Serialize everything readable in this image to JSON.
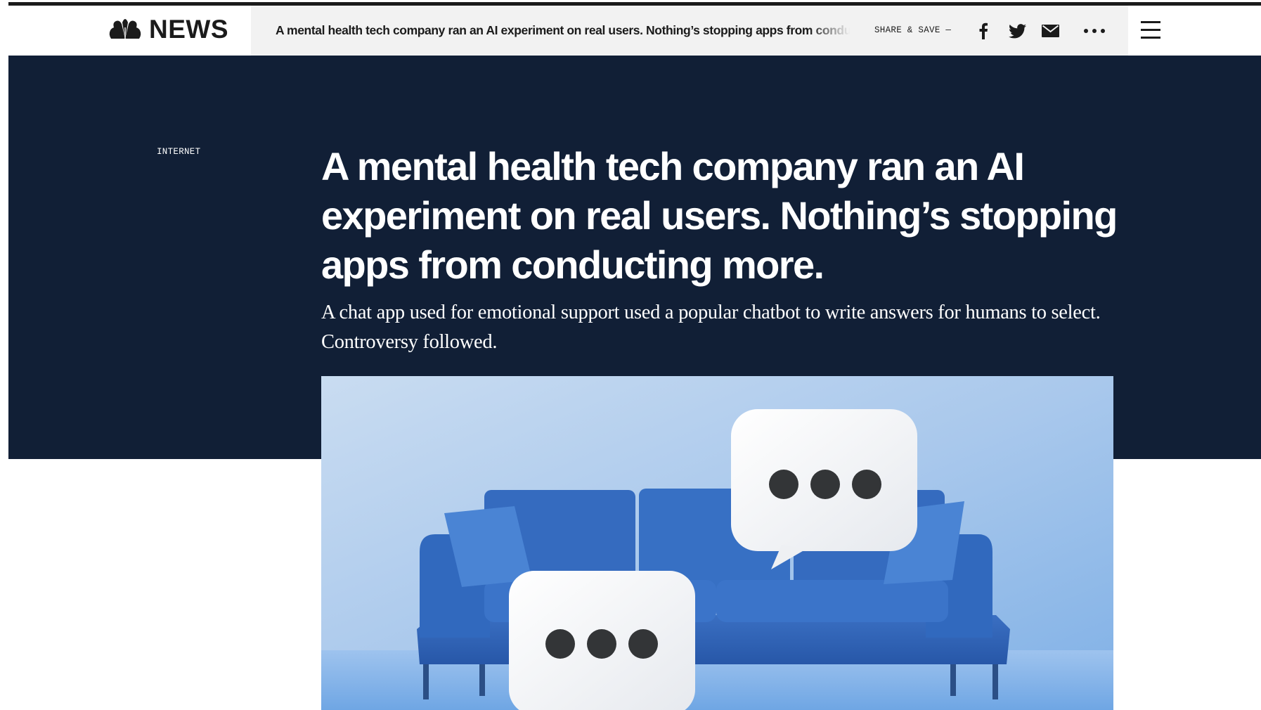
{
  "header": {
    "logo_text": "NEWS",
    "sticky_headline": "A mental health tech company ran an AI experiment on real users. Nothing’s stopping apps from conducting more.",
    "share_label": "SHARE & SAVE —",
    "share_icons": [
      "facebook-icon",
      "twitter-icon",
      "email-icon",
      "more-icon"
    ],
    "menu_icon": "hamburger-menu-icon"
  },
  "article": {
    "section": "INTERNET",
    "headline": "A mental health tech company ran an AI experiment on real users. Nothing’s stopping apps from conducting more.",
    "dek": "A chat app used for emotional support used a popular chatbot to write answers for humans to select. Controversy followed."
  },
  "colors": {
    "hero_background": "#111f36",
    "header_gray": "#f2f2f2",
    "ink": "#1b1b1b",
    "sofa_blue": "#2f64b8"
  }
}
